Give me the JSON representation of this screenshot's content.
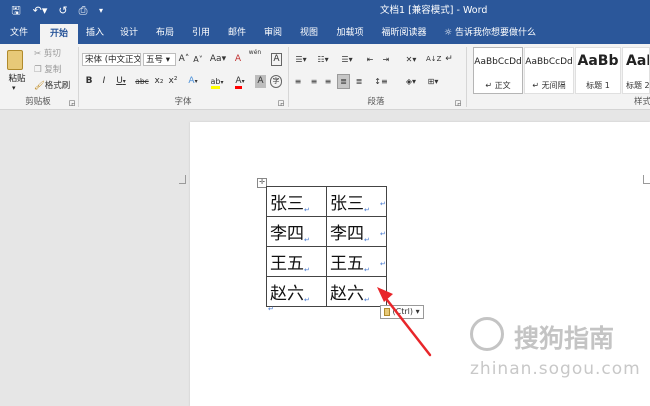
{
  "titlebar": {
    "title": "文档1 [兼容模式] - Word",
    "quick_access": {
      "save": "🖫",
      "undo": "↶▾",
      "redo": "↺",
      "print": "⎙",
      "customize": "▾"
    }
  },
  "tabs": [
    "文件",
    "开始",
    "插入",
    "设计",
    "布局",
    "引用",
    "邮件",
    "审阅",
    "视图",
    "加载项",
    "福昕阅读器"
  ],
  "tell_me": "告诉我你想要做什么",
  "clipboard": {
    "paste": "粘贴",
    "cut": "剪切",
    "copy": "复制",
    "format_painter": "格式刷",
    "label": "剪贴板"
  },
  "font": {
    "font_name": "宋体 (中文正文)",
    "font_size": "五号",
    "grow": "A˄",
    "shrink": "A˅",
    "change_case": "Aa▾",
    "clear_format": "A",
    "wen": "wén",
    "char_border": "A",
    "bold": "B",
    "italic": "I",
    "underline": "U",
    "strikethrough": "abc",
    "subscript": "x₂",
    "superscript": "x²",
    "text_effects": "A",
    "highlight": "ab",
    "font_color": "A",
    "char_shading": "A",
    "circle_char": "字",
    "label": "字体"
  },
  "paragraph": {
    "label": "段落",
    "sort": "A↓Z",
    "marks": "↵"
  },
  "styles": {
    "label": "样式",
    "items": [
      {
        "sample": "AaBbCcDd",
        "name": "↵ 正文"
      },
      {
        "sample": "AaBbCcDd",
        "name": "↵ 无间隔"
      },
      {
        "sample": "AaBb",
        "name": "标题 1"
      },
      {
        "sample": "AaB",
        "name": "标题 2"
      }
    ]
  },
  "document": {
    "rows": [
      [
        "张三",
        "张三"
      ],
      [
        "李四",
        "李四"
      ],
      [
        "王五",
        "王五"
      ],
      [
        "赵六",
        "赵六"
      ]
    ],
    "cell_mark": "↵",
    "row_mark": "↵",
    "move_handle": "✛",
    "after_para_mark": "↵",
    "paste_options": "(Ctrl) ▾"
  },
  "watermark": {
    "name": "搜狗指南",
    "url": "zhinan.sogou.com"
  },
  "colors": {
    "brand": "#2b579a",
    "arrow": "#e8262a",
    "highlight_yellow": "#ffff00",
    "font_red": "#ff0000"
  }
}
